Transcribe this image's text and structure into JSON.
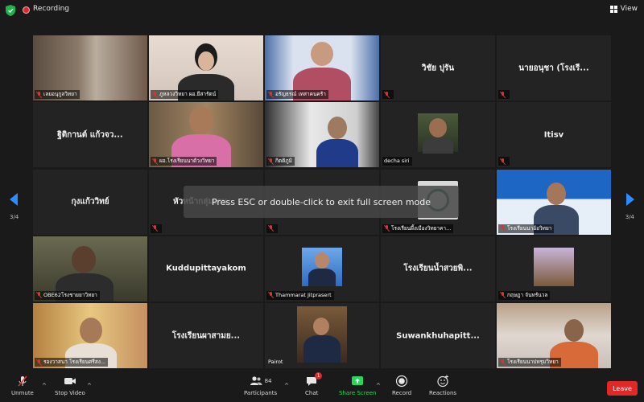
{
  "topbar": {
    "recording_label": "Recording",
    "view_label": "View"
  },
  "overlay": {
    "esc_message": "Press ESC or double-click to exit full screen mode"
  },
  "pagination": {
    "left": "3/4",
    "right": "3/4"
  },
  "tiles": [
    {
      "label": "เลยอนุกูลวิทยา",
      "video": true
    },
    {
      "label": "ภูหลวงวิทยา ผอ.ยีสารัตน์",
      "video": true
    },
    {
      "label": "อรัญธรณ์ เทสาคนคร้า",
      "video": true
    },
    {
      "name": "วิชัย ปุรัน",
      "label": "",
      "video": false
    },
    {
      "name": "นายอนุชา (โรงเรี...",
      "label": "",
      "video": false
    },
    {
      "name": "ฐิติกานต์ แก้วจว...",
      "label": "",
      "video": false
    },
    {
      "label": "ผอ.โรงเรียนนาด้วงวิทยา",
      "video": true
    },
    {
      "label": "กิตติภูมิ",
      "video": true
    },
    {
      "label": "decha siri",
      "video": true
    },
    {
      "name": "Itisv",
      "label": "",
      "video": false
    },
    {
      "name": "กุงแก้ววิทย์",
      "label": "",
      "video": false
    },
    {
      "name": "หัวหน้ากลุ่มงาน",
      "label": "",
      "video": false
    },
    {
      "name": "",
      "label": "",
      "video": false
    },
    {
      "label": "โรงเรียนผึ้งเมืองวิทยาคา...",
      "video": true
    },
    {
      "label": "โรงเรียนนาอ้อวิทยา",
      "video": true
    },
    {
      "label": "OBE62โรงชายยาวิทยา",
      "video": true
    },
    {
      "name": "Kuddupittayakom",
      "label": "",
      "video": false
    },
    {
      "label": "Thammarat Jitprasert",
      "video": true
    },
    {
      "name": "โรงเรียนน้ำสวยพิ...",
      "label": "",
      "video": false
    },
    {
      "label": "กฤษฎา จันทร์นวล",
      "video": true
    },
    {
      "label": "รองวาสนา โรงเรียนศรีสง...",
      "video": true
    },
    {
      "name": "โรงเรียนผาสามย...",
      "label": "",
      "video": false
    },
    {
      "label": "Pairot",
      "video": true,
      "active": true
    },
    {
      "name": "Suwankhuhapitt...",
      "label": "",
      "video": false
    },
    {
      "label": "โรงเรียนนาปทรุมวิทยา",
      "video": true
    }
  ],
  "toolbar": {
    "unmute_label": "Unmute",
    "stop_video_label": "Stop Video",
    "participants_label": "Participants",
    "participants_count": "84",
    "chat_label": "Chat",
    "chat_badge": "1",
    "share_label": "Share Screen",
    "record_label": "Record",
    "reactions_label": "Reactions",
    "leave_label": "Leave"
  },
  "colors": {
    "accent": "#2d8cff",
    "share": "#23d959",
    "leave": "#e02828",
    "active_border": "#c8e04a",
    "tile_bg": "#232323"
  }
}
